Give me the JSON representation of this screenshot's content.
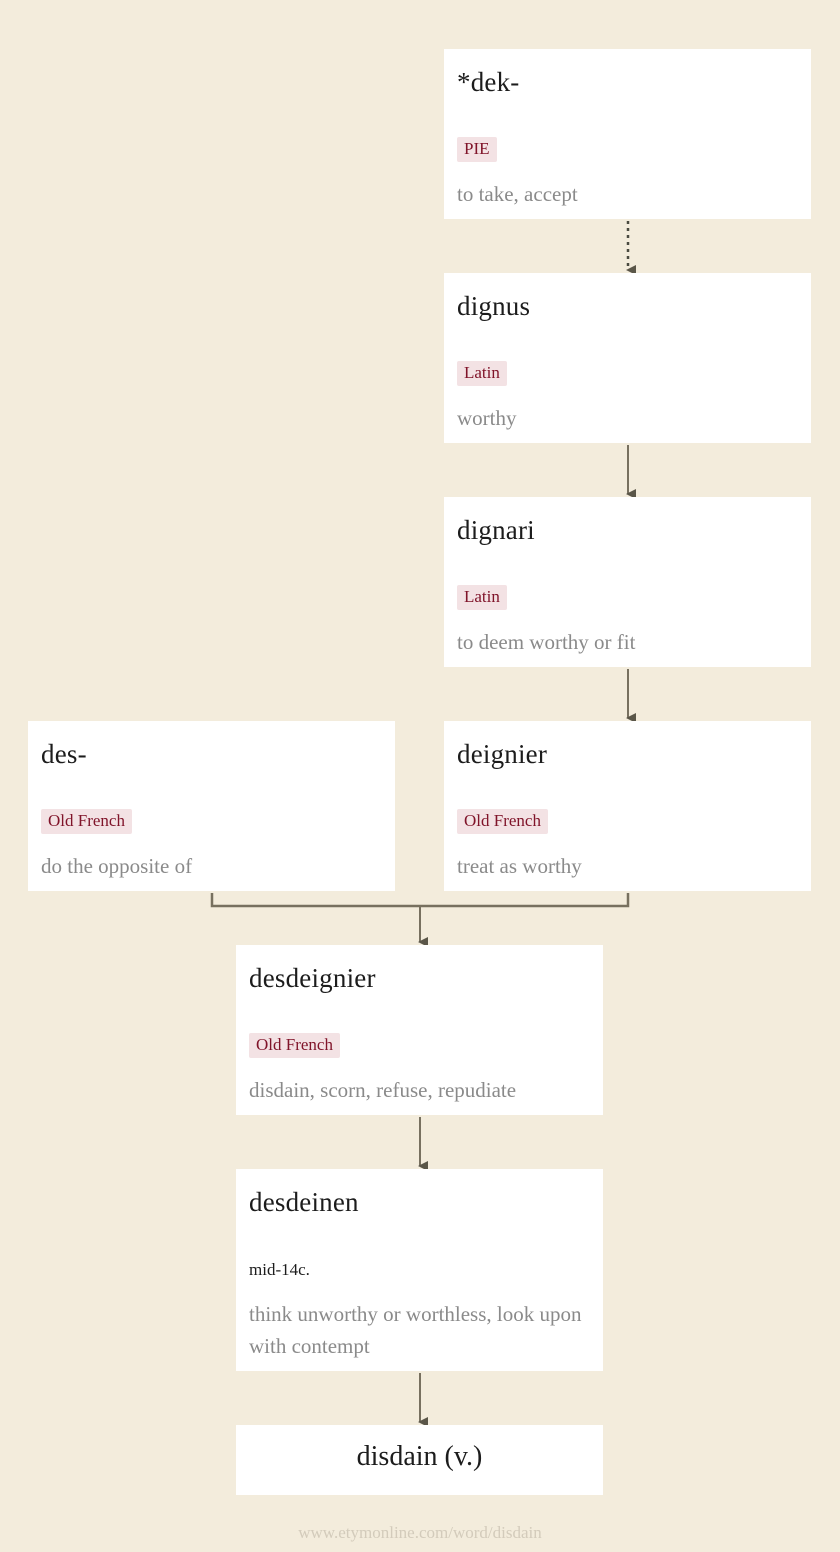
{
  "diagram": {
    "nodes": [
      {
        "id": "dek",
        "word": "*dek-",
        "language": "PIE",
        "gloss": "to take, accept"
      },
      {
        "id": "dignus",
        "word": "dignus",
        "language": "Latin",
        "gloss": "worthy"
      },
      {
        "id": "dignari",
        "word": "dignari",
        "language": "Latin",
        "gloss": "to deem worthy or fit"
      },
      {
        "id": "des",
        "word": "des-",
        "language": "Old French",
        "gloss": "do the opposite of"
      },
      {
        "id": "deignier",
        "word": "deignier",
        "language": "Old French",
        "gloss": "treat as worthy"
      },
      {
        "id": "desdeignier",
        "word": "desdeignier",
        "language": "Old French",
        "gloss": "disdain, scorn, refuse, repudiate"
      },
      {
        "id": "desdeinen",
        "word": "desdeinen",
        "date": "mid-14c.",
        "gloss": "think unworthy or worthless, look upon with contempt"
      },
      {
        "id": "disdain",
        "word": "disdain (v.)"
      }
    ],
    "edges": [
      {
        "from": "dek",
        "to": "dignus",
        "style": "dotted"
      },
      {
        "from": "dignus",
        "to": "dignari",
        "style": "solid"
      },
      {
        "from": "dignari",
        "to": "deignier",
        "style": "solid"
      },
      {
        "from": "des",
        "to": "desdeignier",
        "style": "solid"
      },
      {
        "from": "deignier",
        "to": "desdeignier",
        "style": "solid"
      },
      {
        "from": "desdeignier",
        "to": "desdeinen",
        "style": "solid"
      },
      {
        "from": "desdeinen",
        "to": "disdain",
        "style": "solid"
      }
    ],
    "colors": {
      "background": "#f3ecdc",
      "card": "#ffffff",
      "language_tag_bg": "#f3e2e4",
      "language_tag_text": "#80142a",
      "gloss_text": "#8a8a8a",
      "arrow": "#77705f"
    }
  },
  "footer": {
    "url": "www.etymonline.com/word/disdain"
  }
}
